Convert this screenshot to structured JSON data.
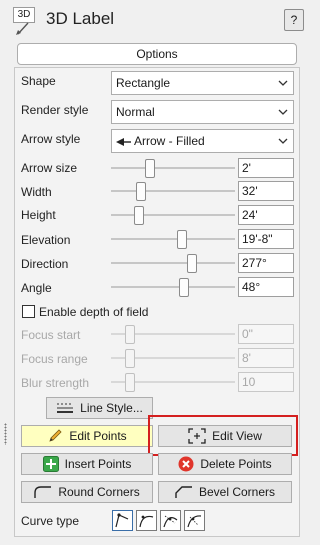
{
  "header": {
    "icon_text": "3D",
    "title": "3D Label",
    "help_label": "?"
  },
  "options_label": "Options",
  "dropdowns": {
    "shape": {
      "label": "Shape",
      "value": "Rectangle"
    },
    "render_style": {
      "label": "Render style",
      "value": "Normal"
    },
    "arrow_style": {
      "label": "Arrow style",
      "value": "Arrow - Filled"
    }
  },
  "sliders": {
    "arrow_size": {
      "label": "Arrow size",
      "value": "2'",
      "level": 0.3
    },
    "width": {
      "label": "Width",
      "value": "32'",
      "level": 0.22
    },
    "height": {
      "label": "Height",
      "value": "24'",
      "level": 0.2
    },
    "elevation": {
      "label": "Elevation",
      "value": "19'-8\"",
      "level": 0.58
    },
    "direction": {
      "label": "Direction",
      "value": "277°",
      "level": 0.67
    },
    "angle": {
      "label": "Angle",
      "value": "48°",
      "level": 0.6
    }
  },
  "depth_of_field": {
    "checkbox_label": "Enable depth of field",
    "checked": false,
    "focus_start": {
      "label": "Focus start",
      "value": "0\"",
      "level": 0.12
    },
    "focus_range": {
      "label": "Focus range",
      "value": "8'",
      "level": 0.12
    },
    "blur_strength": {
      "label": "Blur strength",
      "value": "10",
      "level": 0.12
    }
  },
  "buttons": {
    "line_style": "Line Style...",
    "edit_points": "Edit Points",
    "edit_view": "Edit View",
    "insert_points": "Insert Points",
    "delete_points": "Delete Points",
    "round_corners": "Round Corners",
    "bevel_corners": "Bevel Corners"
  },
  "curve_type_label": "Curve type",
  "colors": {
    "highlight_button": "#ffffc0",
    "annotation_box": "#d41f1f",
    "insert_green": "#3aa84a",
    "delete_red": "#e0352b"
  }
}
